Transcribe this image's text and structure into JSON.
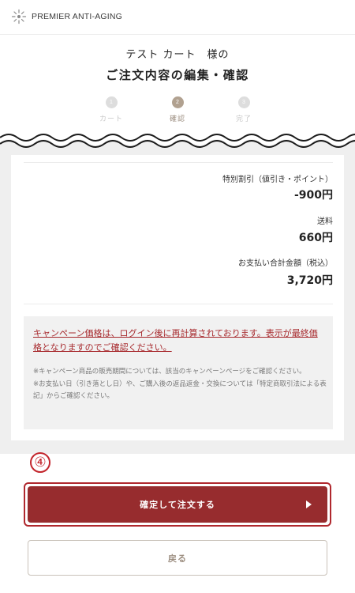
{
  "header": {
    "brand": "PREMIER ANTI-AGING",
    "logo_icon": "sunburst-logo-icon"
  },
  "title": {
    "customer": "テスト カート　様の",
    "heading": "ご注文内容の編集・確認"
  },
  "steps": [
    {
      "number": "1",
      "label": "カート",
      "active": false
    },
    {
      "number": "2",
      "label": "確認",
      "active": true
    },
    {
      "number": "3",
      "label": "完了",
      "active": false
    }
  ],
  "totals": {
    "discount_label": "特別割引（値引き・ポイント）",
    "discount_value": "-900円",
    "shipping_label": "送料",
    "shipping_value": "660円",
    "grand_label": "お支払い合計金額（税込）",
    "grand_value": "3,720円"
  },
  "notice": {
    "red_text": "キャンペーン価格は、ログイン後に再計算されております。表示が最終価格となりますのでご確認ください。",
    "line1": "※キャンペーン商品の販売期間については、該当のキャンペーンページをご確認ください。",
    "line2": "※お支払い日（引き落とし日）や、ご購入後の返品返金・交換については「特定商取引法による表記」からご確認ください。"
  },
  "marker": "④",
  "buttons": {
    "confirm": "確定して注文する",
    "back": "戻る",
    "confirm_icon": "play-triangle-icon"
  },
  "colors": {
    "brand_red": "#972c2e",
    "notice_red": "#a7292d",
    "step_active": "#b1a190",
    "outline_red": "#b0282e"
  }
}
